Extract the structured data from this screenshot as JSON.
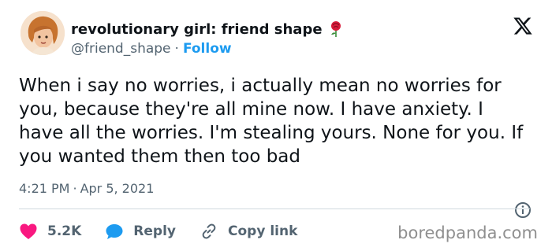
{
  "author": {
    "display_name": "revolutionary girl: friend shape",
    "handle": "@friend_shape",
    "separator": "·",
    "follow_label": "Follow"
  },
  "tweet": {
    "text": "When i say no worries, i actually mean no worries for you, because they're all mine now. I have anxiety. I have all the worries. I'm stealing yours. None for you. If you wanted them then too bad",
    "time": "4:21 PM",
    "separator": "·",
    "date": "Apr 5, 2021"
  },
  "actions": {
    "likes": "5.2K",
    "reply_label": "Reply",
    "copy_link_label": "Copy link"
  },
  "watermark": "boredpanda.com",
  "colors": {
    "accent": "#1d9bf0",
    "heart": "#f91880",
    "text": "#0f1419",
    "muted": "#536471"
  },
  "icons": {
    "platform": "x-logo-icon",
    "emoji": "rose-icon",
    "like": "heart-icon",
    "reply": "speech-bubble-icon",
    "copy": "link-icon",
    "info": "info-icon"
  }
}
